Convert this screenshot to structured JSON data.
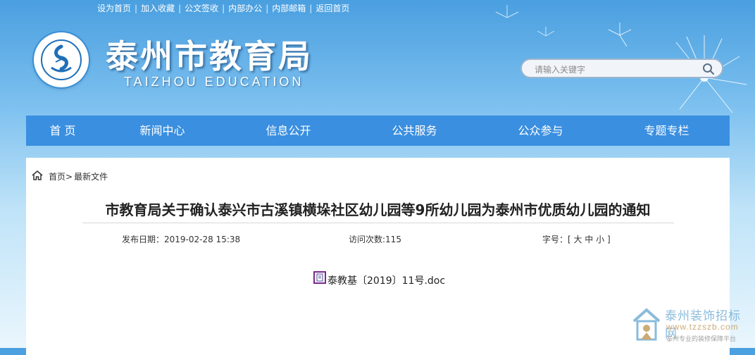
{
  "top_links": [
    "设为首页",
    "加入收藏",
    "公文签收",
    "内部办公",
    "内部邮箱",
    "返回首页"
  ],
  "header": {
    "title": "泰州市教育局",
    "subtitle": "TAIZHOU EDUCATION"
  },
  "search": {
    "placeholder": "请输入关键字"
  },
  "nav": [
    "首 页",
    "新闻中心",
    "信息公开",
    "公共服务",
    "公众参与",
    "专题专栏"
  ],
  "breadcrumb": {
    "home": "首页>",
    "current": "最新文件"
  },
  "article": {
    "title": "市教育局关于确认泰兴市古溪镇横垛社区幼儿园等9所幼儿园为泰州市优质幼儿园的通知",
    "publish_date": "发布日期：2019-02-28 15:38",
    "visits": "访问次数:115",
    "font_size": "字号：[ 大 中 小 ]",
    "attachment": "泰教基〔2019〕11号.doc"
  },
  "watermark": {
    "title": "泰州装饰招标网",
    "url": "www.tzzszb.com",
    "slogan": "泰州专业的装修保障平台"
  },
  "colors": {
    "nav": "#3a8fe0",
    "title_text": "#ffffff",
    "attachment_icon": "#7a2a8a"
  }
}
